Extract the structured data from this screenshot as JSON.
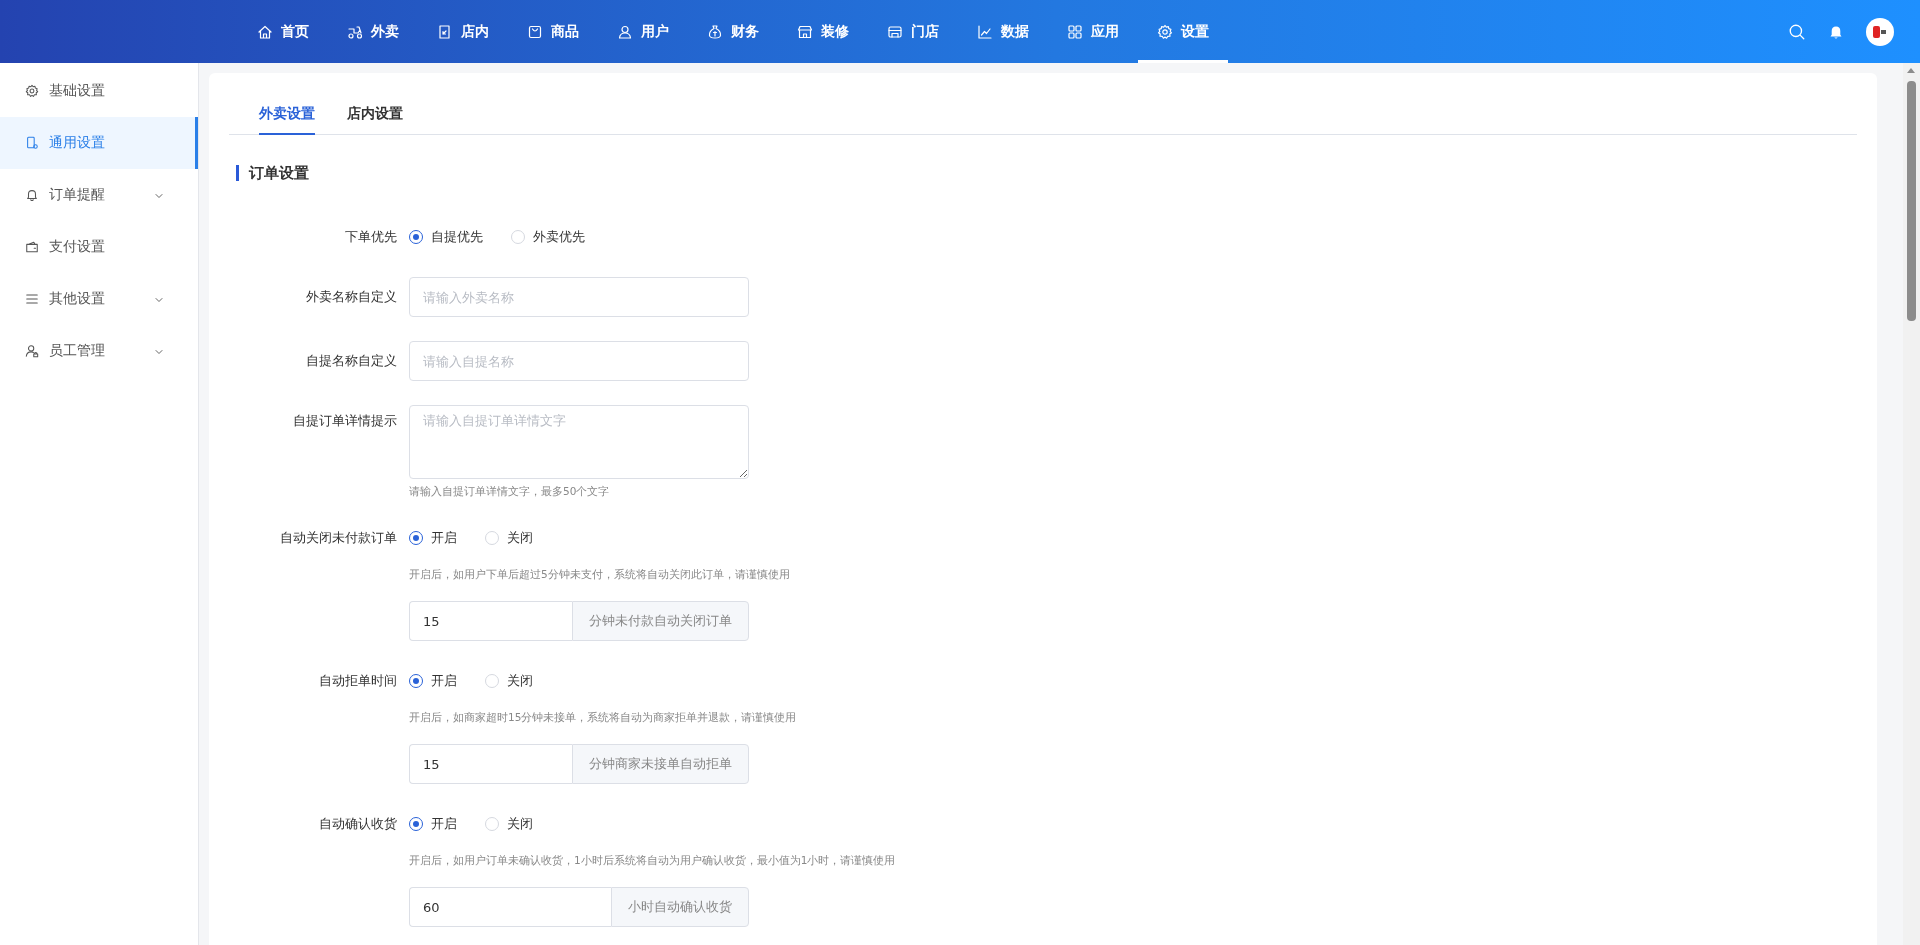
{
  "top_nav": [
    {
      "label": "首页",
      "selected": false
    },
    {
      "label": "外卖",
      "selected": false
    },
    {
      "label": "店内",
      "selected": false
    },
    {
      "label": "商品",
      "selected": false
    },
    {
      "label": "用户",
      "selected": false
    },
    {
      "label": "财务",
      "selected": false
    },
    {
      "label": "装修",
      "selected": false
    },
    {
      "label": "门店",
      "selected": false
    },
    {
      "label": "数据",
      "selected": false
    },
    {
      "label": "应用",
      "selected": false
    },
    {
      "label": "设置",
      "selected": true
    }
  ],
  "sidebar": {
    "items": [
      {
        "label": "基础设置",
        "selected": false,
        "expandable": false
      },
      {
        "label": "通用设置",
        "selected": true,
        "expandable": false
      },
      {
        "label": "订单提醒",
        "selected": false,
        "expandable": true
      },
      {
        "label": "支付设置",
        "selected": false,
        "expandable": false
      },
      {
        "label": "其他设置",
        "selected": false,
        "expandable": true
      },
      {
        "label": "员工管理",
        "selected": false,
        "expandable": true
      }
    ]
  },
  "tabs": [
    {
      "label": "外卖设置",
      "selected": true
    },
    {
      "label": "店内设置",
      "selected": false
    }
  ],
  "section_title": "订单设置",
  "fields": [
    {
      "kind": "radio",
      "label": "下单优先",
      "options": [
        {
          "label": "自提优先",
          "selected": true
        },
        {
          "label": "外卖优先",
          "selected": false
        }
      ]
    },
    {
      "kind": "input",
      "label": "外卖名称自定义",
      "placeholder": "请输入外卖名称"
    },
    {
      "kind": "input",
      "label": "自提名称自定义",
      "placeholder": "请输入自提名称"
    },
    {
      "kind": "textarea",
      "label": "自提订单详情提示",
      "placeholder": "请输入自提订单详情文字",
      "hint": "请输入自提订单详情文字，最多50个文字"
    },
    {
      "kind": "radio",
      "label": "自动关闭未付款订单",
      "options": [
        {
          "label": "开启",
          "selected": true
        },
        {
          "label": "关闭",
          "selected": false
        }
      ],
      "hint": "开启后，如用户下单后超过5分钟未支付，系统将自动关闭此订单，请谨慎使用",
      "number": {
        "value": "15",
        "addon": "分钟未付款自动关闭订单"
      }
    },
    {
      "kind": "radio",
      "label": "自动拒单时间",
      "options": [
        {
          "label": "开启",
          "selected": true
        },
        {
          "label": "关闭",
          "selected": false
        }
      ],
      "hint": "开启后，如商家超时15分钟未接单，系统将自动为商家拒单并退款，请谨慎使用",
      "number": {
        "value": "15",
        "addon": "分钟商家未接单自动拒单"
      }
    },
    {
      "kind": "radio",
      "label": "自动确认收货",
      "options": [
        {
          "label": "开启",
          "selected": true
        },
        {
          "label": "关闭",
          "selected": false
        }
      ],
      "hint": "开启后，如用户订单未确认收货，1小时后系统将自动为用户确认收货，最小值为1小时，请谨慎使用",
      "number": {
        "value": "60",
        "addon": "小时自动确认收货"
      }
    }
  ]
}
